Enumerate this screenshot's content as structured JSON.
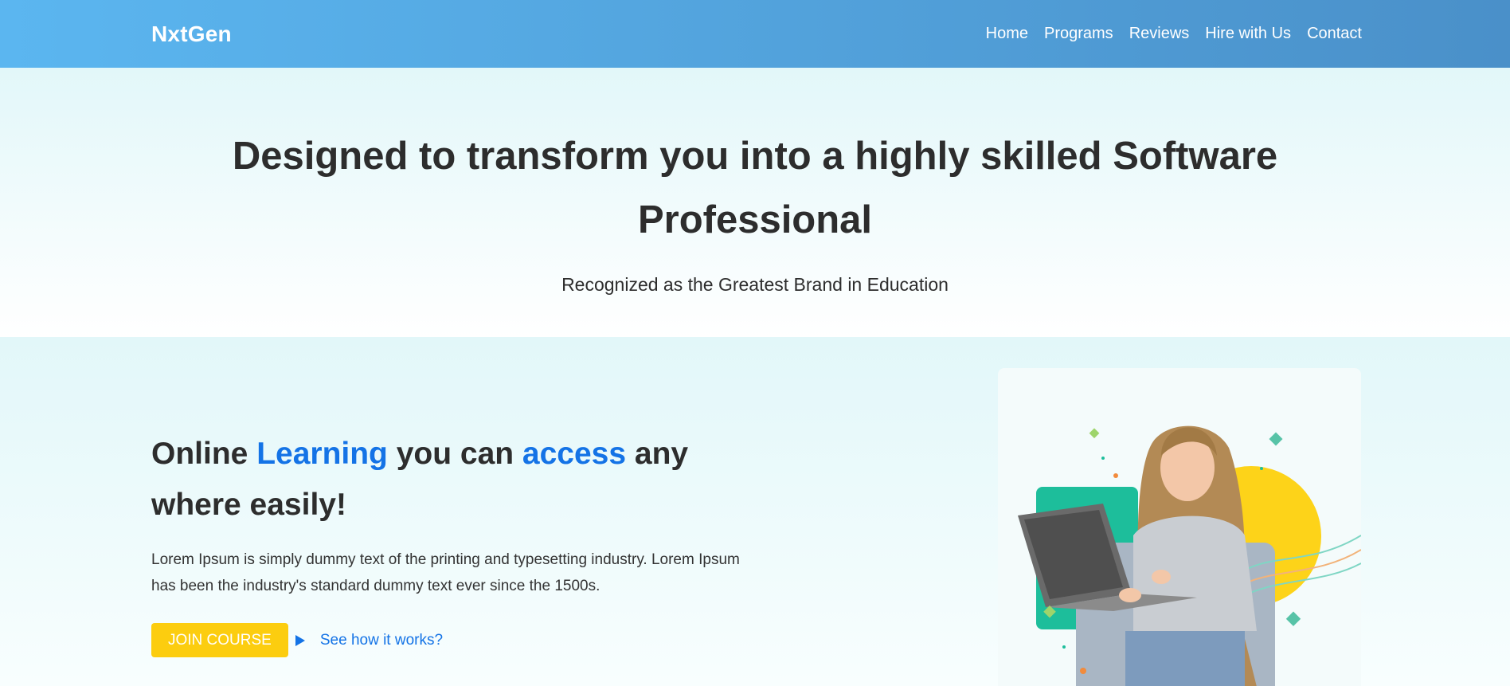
{
  "nav": {
    "brand": "NxtGen",
    "links": [
      "Home",
      "Programs",
      "Reviews",
      "Hire with Us",
      "Contact"
    ]
  },
  "hero": {
    "title": "Designed to transform you into a highly skilled Software Professional",
    "subtitle": "Recognized as the Greatest Brand in Education"
  },
  "feature": {
    "heading_parts": [
      "Online ",
      "Learning",
      " you can ",
      "access",
      " any where easily!"
    ],
    "description": "Lorem Ipsum is simply dummy text of the printing and typesetting industry. Lorem Ipsum has been the industry's standard dummy text ever since the 1500s.",
    "join_label": "JOIN COURSE",
    "see_label": "See how it works?"
  },
  "colors": {
    "accent": "#1473e6",
    "button": "#fccd0f",
    "nav_start": "#5bb6f0",
    "nav_end": "#4a90c9"
  },
  "icons": {
    "play": "play-icon"
  }
}
